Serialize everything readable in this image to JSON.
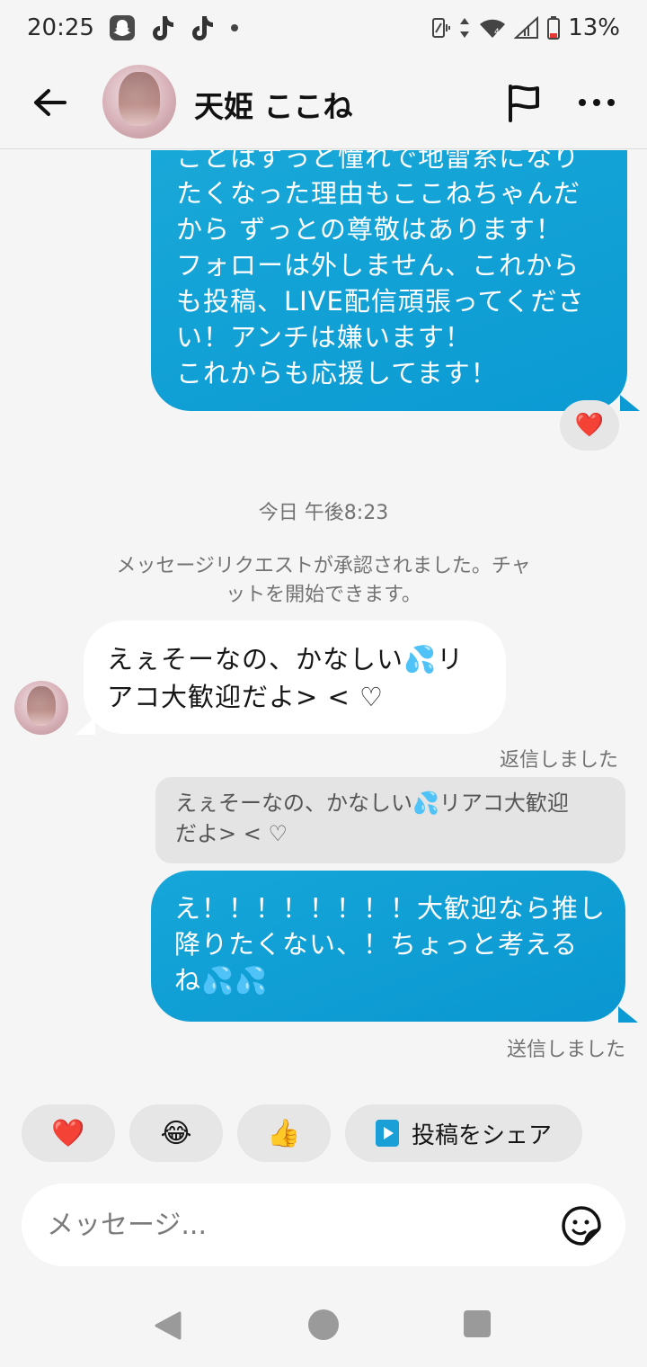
{
  "status_bar": {
    "time": "20:25",
    "battery": "13%",
    "icons": [
      "snapchat-icon",
      "tiktok-icon",
      "tiktok-icon",
      "dot-icon",
      "vibrate-icon",
      "data-arrows-icon",
      "wifi-icon",
      "signal-icon",
      "battery-icon"
    ]
  },
  "header": {
    "name": "天姫 ここね"
  },
  "messages": {
    "sent_top_text": "ことはずっと憧れで地雷系になり\nたくなった理由もここねちゃんだ\nから  ずっとの尊敬はあります！\nフォローは外しません、これから\nも投稿、LIVE配信頑張ってくださ\nい！アンチは嫌います！\nこれからも応援してます！",
    "reaction": "❤️",
    "timestamp": "今日 午後8:23",
    "system_note": "メッセージリクエストが承認されました。チャ\nットを開始できます。",
    "received_text": "えぇそーなの、かなしい💦リ\nアコ大歓迎だよ> < ♡",
    "replied_label": "返信しました",
    "reply_quote": "えぇそーなの、かなしい💦リアコ大歓迎\nだよ> < ♡",
    "sent_text": "え！！！！！！！！大歓迎なら推し\n降りたくない、！ちょっと考える\nね💦💦",
    "sent_label": "送信しました"
  },
  "quick_replies": {
    "heart": "❤️",
    "laugh": "😂",
    "thumbs": "👍",
    "share_label": "投稿をシェア"
  },
  "composer": {
    "placeholder": "メッセージ..."
  },
  "colors": {
    "bubble_sent": "#0b9ad3",
    "bubble_received": "#ffffff",
    "background": "#f5f5f5"
  }
}
